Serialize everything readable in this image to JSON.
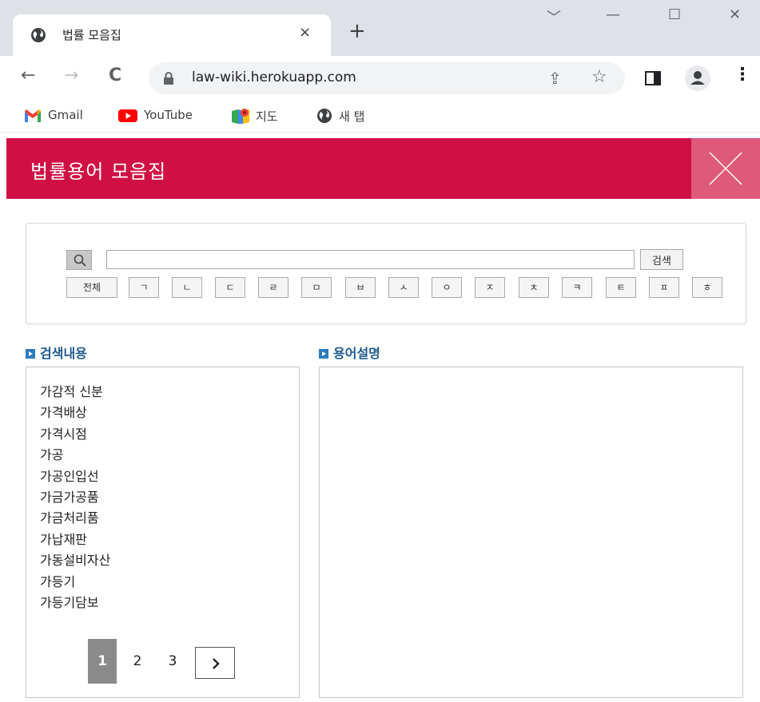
{
  "browser": {
    "tab_title": "법률 모음집",
    "tab_close": "×",
    "new_tab": "+",
    "window_controls": {
      "dropdown": "﹀",
      "minimize": "—",
      "maximize": "☐",
      "close": "✕"
    },
    "back": "←",
    "forward": "→",
    "reload": "C",
    "url": "law-wiki.herokuapp.com",
    "share_icon": "⇪",
    "star_icon": "☆",
    "menu_icon": "⋮",
    "bookmarks": [
      {
        "label": "Gmail",
        "icon": "gmail-icon"
      },
      {
        "label": "YouTube",
        "icon": "youtube-icon"
      },
      {
        "label": "지도",
        "icon": "maps-icon"
      },
      {
        "label": "새 탭",
        "icon": "globe-icon"
      }
    ]
  },
  "page": {
    "title": "법률용어 모음집",
    "header_color": "#d01045",
    "close_box_color": "#dd5a7a"
  },
  "search": {
    "placeholder": "",
    "value": "",
    "button_label": "검색",
    "letters": [
      "전체",
      "ㄱ",
      "ㄴ",
      "ㄷ",
      "ㄹ",
      "ㅁ",
      "ㅂ",
      "ㅅ",
      "ㅇ",
      "ㅈ",
      "ㅊ",
      "ㅋ",
      "ㅌ",
      "ㅍ",
      "ㅎ"
    ]
  },
  "results": {
    "heading": "검색내용",
    "items": [
      "가감적 신분",
      "가격배상",
      "가격시점",
      "가공",
      "가공인입선",
      "가금가공품",
      "가금처리품",
      "가납재판",
      "가동설비자산",
      "가등기",
      "가등기담보"
    ],
    "pages": [
      "1",
      "2",
      "3"
    ],
    "current_page": "1"
  },
  "description": {
    "heading": "용어설명"
  }
}
